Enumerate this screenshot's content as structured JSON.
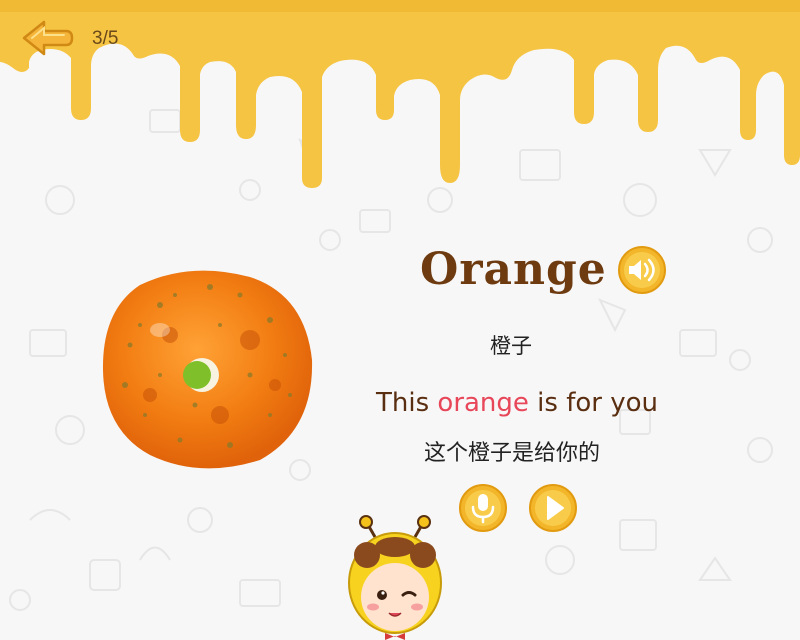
{
  "header": {
    "progress": "3/5"
  },
  "card": {
    "word": "Orange",
    "word_cn": "橙子",
    "sentence_before": "This ",
    "sentence_highlight": "orange",
    "sentence_after": " is for you",
    "sentence_cn": "这个橙子是给你的"
  },
  "icons": {
    "back": "back-arrow-icon",
    "speaker": "speaker-icon",
    "mic": "microphone-icon",
    "play": "play-icon"
  },
  "colors": {
    "honey": "#f6c443",
    "honey_dark": "#e9a91d",
    "word_brown": "#6e3b10",
    "highlight": "#e8475a"
  }
}
